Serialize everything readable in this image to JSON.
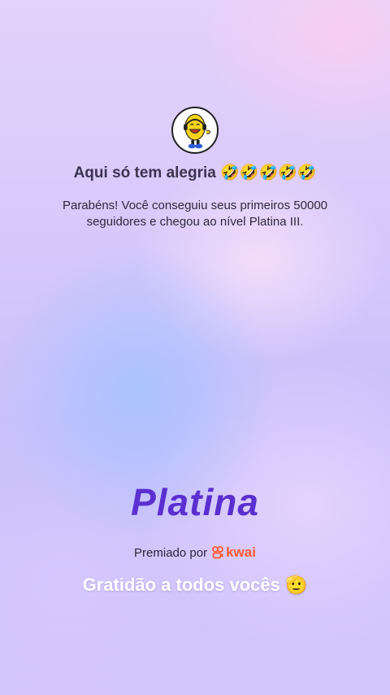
{
  "profile": {
    "avatar_icon": "laughing-character-icon"
  },
  "post": {
    "title": "Aqui só tem alegria 🤣🤣🤣🤣🤣",
    "description": "Parabéns! Você conseguiu seus primeiros 50000 seguidores e chegou ao nível Platina III."
  },
  "tier": {
    "label": "Platina"
  },
  "award": {
    "prefix": "Premiado por",
    "brand": "kwai",
    "brand_color": "#ff5a2c"
  },
  "caption": {
    "text": "Gratidão a todos vocês 🫡"
  },
  "colors": {
    "tier_text": "#5a2fd0",
    "caption_text": "#ffffff"
  }
}
